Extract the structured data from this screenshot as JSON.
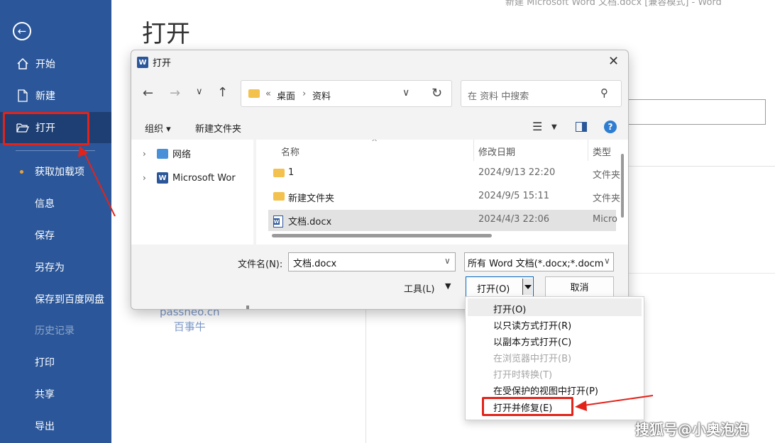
{
  "window_title_hint": "新建 Microsoft Word 文档.docx [兼容模式] - Word",
  "backstage": {
    "page_title": "打开",
    "nav": {
      "home": "开始",
      "new": "新建",
      "open": "打开",
      "addins": "获取加载项",
      "info": "信息",
      "save": "保存",
      "save_as": "另存为",
      "save_baidu": "保存到百度网盘",
      "history": "历史记录",
      "print": "打印",
      "share": "共享",
      "export": "导出"
    }
  },
  "dialog": {
    "title": "打开",
    "breadcrumb": [
      "桌面",
      "资料"
    ],
    "search_placeholder": "在 资料 中搜索",
    "toolbar": {
      "organize": "组织 ▾",
      "new_folder": "新建文件夹"
    },
    "nav_tree": [
      {
        "label": "网络",
        "icon": "network-icon"
      },
      {
        "label": "Microsoft Wor",
        "icon": "word-icon"
      }
    ],
    "columns": {
      "name": "名称",
      "date": "修改日期",
      "type": "类型"
    },
    "files": [
      {
        "name": "1",
        "date": "2024/9/13 22:20",
        "type": "文件夹",
        "icon": "folder-icon",
        "selected": false
      },
      {
        "name": "新建文件夹",
        "date": "2024/9/5 15:11",
        "type": "文件夹",
        "icon": "folder-icon",
        "selected": false
      },
      {
        "name": "文档.docx",
        "date": "2024/4/3 22:06",
        "type": "Micro",
        "icon": "word-doc-icon",
        "selected": true
      }
    ],
    "filename_label": "文件名(N):",
    "filename_value": "文档.docx",
    "filetype_value": "所有 Word 文档(*.docx;*.docm",
    "tools_label": "工具(L)",
    "open_button": "打开(O)",
    "cancel_button": "取消"
  },
  "open_menu": {
    "items": [
      {
        "label": "打开(O)",
        "enabled": true,
        "highlighted": true
      },
      {
        "label": "以只读方式打开(R)",
        "enabled": true
      },
      {
        "label": "以副本方式打开(C)",
        "enabled": true
      },
      {
        "label": "在浏览器中打开(B)",
        "enabled": false
      },
      {
        "label": "打开时转换(T)",
        "enabled": false
      },
      {
        "label": "在受保护的视图中打开(P)",
        "enabled": true
      },
      {
        "label": "打开并修复(E)",
        "enabled": true,
        "annotated": true
      }
    ]
  },
  "watermark": {
    "line1": "passneo.cn",
    "line2": "百事牛"
  },
  "corner_watermark": "搜狐号@小奥泡泡",
  "colors": {
    "sidebar": "#2b579a",
    "sidebar_active": "#1e3f73",
    "annotation_red": "#e2231a",
    "accent_blue": "#0067c0"
  }
}
